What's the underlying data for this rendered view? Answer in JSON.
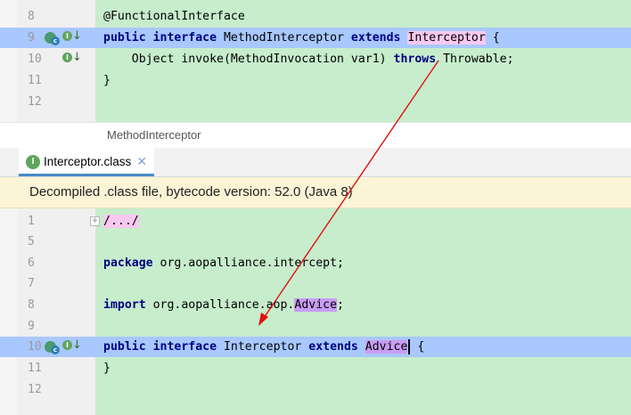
{
  "top_editor": {
    "lines": [
      {
        "num": "8",
        "text": "@FunctionalInterface"
      },
      {
        "num": "9",
        "kw1": "public interface",
        "name": " MethodInterceptor ",
        "kw2": "extends",
        "sp": " ",
        "target": "Interceptor",
        "tail": " {"
      },
      {
        "num": "10",
        "pre": "    Object invoke(MethodInvocation var1) ",
        "kw": "throws",
        "tail": " Throwable;"
      },
      {
        "num": "11",
        "text": "}"
      },
      {
        "num": "12",
        "text": ""
      }
    ],
    "breadcrumb": "MethodInterceptor"
  },
  "tab": {
    "icon": "I",
    "label": "Interceptor.class",
    "close": "✕"
  },
  "banner": "Decompiled .class file, bytecode version: 52.0 (Java 8)",
  "bottom_editor": {
    "lines": [
      {
        "num": "1",
        "text": "/.../"
      },
      {
        "num": "5",
        "text": ""
      },
      {
        "num": "6",
        "kw": "package",
        "tail": " org.aopalliance.intercept;"
      },
      {
        "num": "7",
        "text": ""
      },
      {
        "num": "8",
        "kw": "import",
        "pre": " org.aopalliance.aop.",
        "target": "Advice",
        "tail": ";"
      },
      {
        "num": "9",
        "text": ""
      },
      {
        "num": "10",
        "kw1": "public interface",
        "name": " Interceptor ",
        "kw2": "extends",
        "sp": " ",
        "target": "Advice",
        "tail": " {"
      },
      {
        "num": "11",
        "text": "}"
      },
      {
        "num": "12",
        "text": ""
      }
    ]
  },
  "icons": {
    "gutter_class": "I",
    "gutter_c": "c",
    "arrow": "↓"
  },
  "colors": {
    "editor_bg": "#c7edcc",
    "highlight_line": "#a8c8ff",
    "annotation_arrow": "#e01010"
  }
}
